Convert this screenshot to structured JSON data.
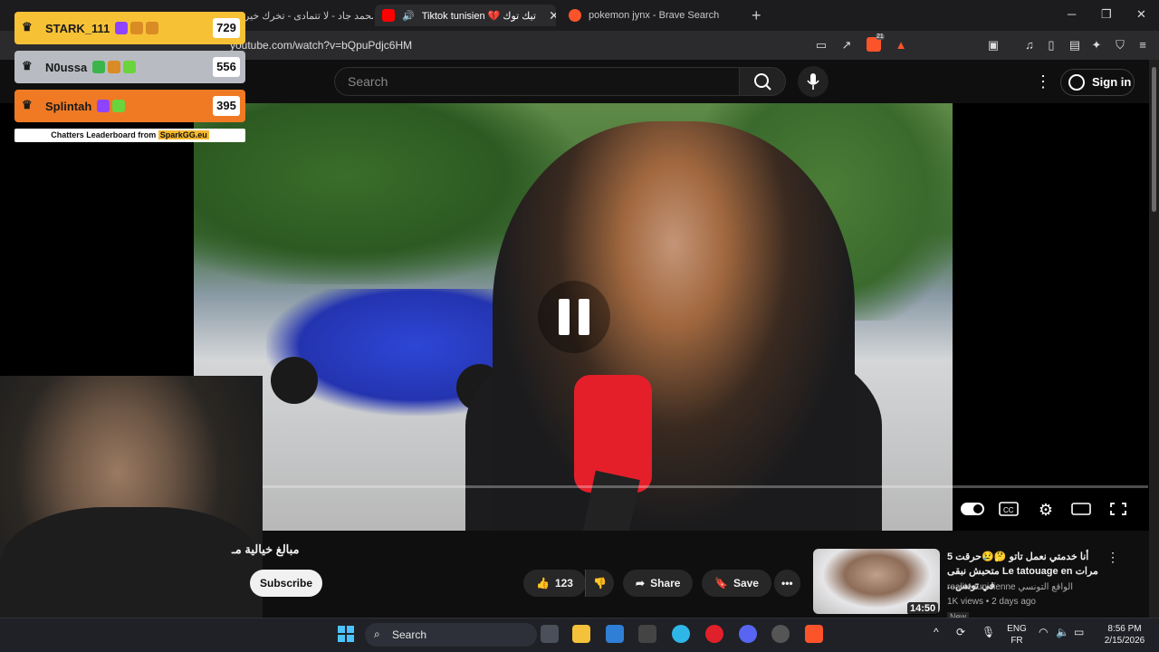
{
  "browser": {
    "tabs": [
      {
        "label": "محمد جاد - لا تتمادى - تخرك خير",
        "active": false
      },
      {
        "label": "Tiktok tunisien 💔 تيك توك",
        "active": true
      },
      {
        "label": "pokemon jynx - Brave Search",
        "active": false
      }
    ],
    "url": "youtube.com/watch?v=bQpuPdjc6HM",
    "brave_shield_count": "21",
    "rewards_badge": "1"
  },
  "youtube": {
    "search_placeholder": "Search",
    "sign_in_label": "Sign in"
  },
  "player": {
    "progress_fraction": 0.155,
    "state": "paused"
  },
  "leaderboard": {
    "rows": [
      {
        "name": "STARK_111",
        "score": "729",
        "color": "#f7c136"
      },
      {
        "name": "N0ussa",
        "score": "556",
        "color": "#b8bcc2"
      },
      {
        "name": "Splintah",
        "score": "395",
        "color": "#f07a24"
      }
    ],
    "footer_prefix": "Chatters Leaderboard from",
    "footer_brand": "SparkGG.eu"
  },
  "video_meta": {
    "title_partial": "مبالغ خيالية مـ",
    "subscribe_label": "Subscribe",
    "like_count": "123",
    "share_label": "Share",
    "save_label": "Save"
  },
  "related": {
    "title": "أنا خدمتي نعمل تاتو 🤔😢حرقت 5 مرات Le tatouage en متحبش نبقى في تونس...",
    "channel": "realite tunisienne الواقع التونسي",
    "meta": "1K views • 2 days ago",
    "duration": "14:50",
    "badge": "New"
  },
  "taskbar": {
    "search_label": "Search",
    "lang_top": "ENG",
    "lang_bottom": "FR",
    "time": "8:56 PM",
    "date": "2/15/2026"
  },
  "colors": {
    "accent_red": "#ff0000",
    "brave_orange": "#fb542b"
  }
}
